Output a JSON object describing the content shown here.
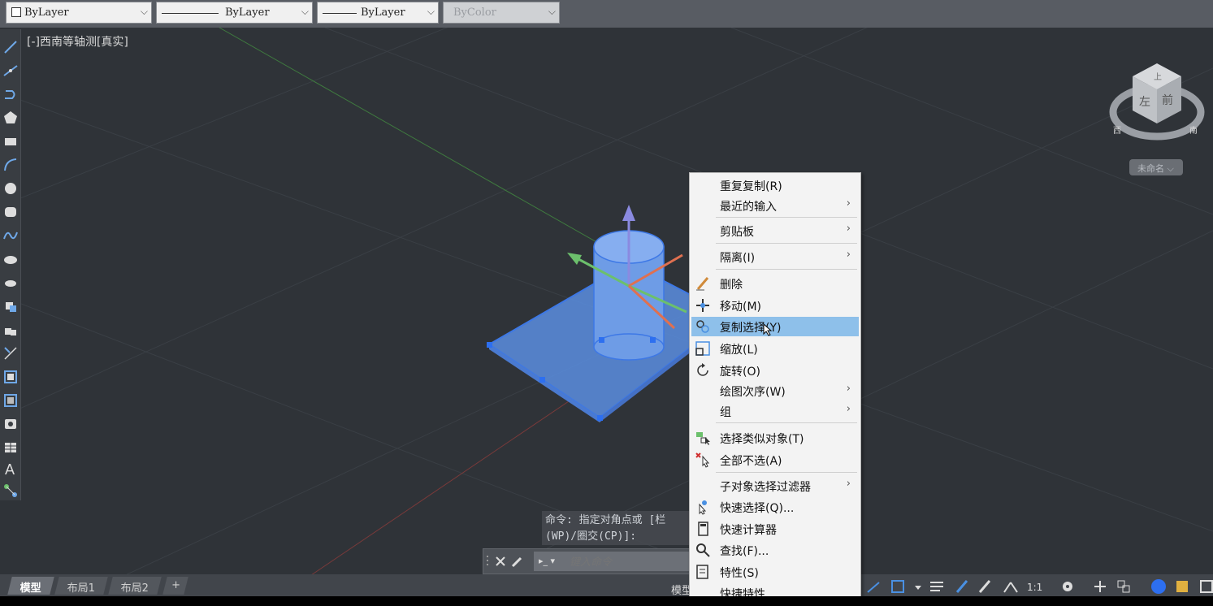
{
  "properties_bar": {
    "color": "ByLayer",
    "linetype": "ByLayer",
    "lineweight": "ByLayer",
    "plotstyle": "ByColor"
  },
  "viewport": {
    "label": "[-]西南等轴测[真实]"
  },
  "viewcube": {
    "top": "上",
    "face_front": "左",
    "face_right": "前",
    "compass_w": "西",
    "compass_s": "南",
    "view_name": "未命名"
  },
  "command": {
    "history_line1": "命令: 指定对角点或 [栏",
    "history_line2": "(WP)/圈交(CP)]:",
    "input_placeholder": "键入命令"
  },
  "tabs": [
    {
      "label": "模型"
    },
    {
      "label": "布局1"
    },
    {
      "label": "布局2"
    }
  ],
  "status": {
    "model_label": "模型",
    "scale": "1:1"
  },
  "context_menu": {
    "items": [
      {
        "label": "重复复制(R)",
        "submenu": false,
        "icon": ""
      },
      {
        "label": "最近的输入",
        "submenu": true,
        "icon": ""
      },
      {
        "label": "剪贴板",
        "submenu": true,
        "icon": ""
      },
      {
        "label": "隔离(I)",
        "submenu": true,
        "icon": ""
      },
      {
        "label": "删除",
        "submenu": false,
        "icon": "eraser-icon"
      },
      {
        "label": "移动(M)",
        "submenu": false,
        "icon": "move-icon"
      },
      {
        "label": "复制选择(Y)",
        "submenu": false,
        "icon": "copy-icon",
        "highlighted": true
      },
      {
        "label": "缩放(L)",
        "submenu": false,
        "icon": "scale-icon"
      },
      {
        "label": "旋转(O)",
        "submenu": false,
        "icon": "rotate-icon"
      },
      {
        "label": "绘图次序(W)",
        "submenu": true,
        "icon": ""
      },
      {
        "label": "组",
        "submenu": true,
        "icon": ""
      },
      {
        "label": "选择类似对象(T)",
        "submenu": false,
        "icon": "select-similar-icon"
      },
      {
        "label": "全部不选(A)",
        "submenu": false,
        "icon": "deselect-all-icon"
      },
      {
        "label": "子对象选择过滤器",
        "submenu": true,
        "icon": ""
      },
      {
        "label": "快速选择(Q)...",
        "submenu": false,
        "icon": "quick-select-icon"
      },
      {
        "label": "快速计算器",
        "submenu": false,
        "icon": "calculator-icon"
      },
      {
        "label": "查找(F)...",
        "submenu": false,
        "icon": "find-icon"
      },
      {
        "label": "特性(S)",
        "submenu": false,
        "icon": "properties-icon"
      },
      {
        "label": "快捷特性",
        "submenu": false,
        "icon": ""
      }
    ]
  },
  "colors": {
    "canvas_bg": "#2f3338",
    "selection_blue": "#5b8ee0",
    "menu_highlight": "#8ec0ea"
  }
}
